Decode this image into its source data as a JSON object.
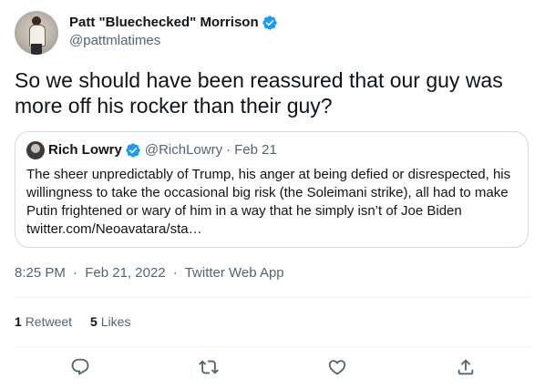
{
  "author": {
    "display_name": "Patt \"Bluechecked\" Morrison",
    "handle": "@pattmlatimes",
    "verified_icon": "verified-badge-icon"
  },
  "tweet": {
    "text": "So we should have been reassured that our guy was more off his rocker than their guy?"
  },
  "quoted_tweet": {
    "display_name": "Rich Lowry",
    "handle": "@RichLowry",
    "separator": "·",
    "date": "Feb 21",
    "text": "The sheer unpredictably of Trump, his anger at being defied or disrespected, his willingness to take the occasional big risk (the Soleimani strike), all had to make Putin frightened or wary of him in a way that he simply isn’t of Joe Biden twitter.com/Neoavatara/sta…"
  },
  "meta": {
    "time": "8:25 PM",
    "separator_1": "·",
    "date": "Feb 21, 2022",
    "separator_2": "·",
    "source": "Twitter Web App"
  },
  "stats": {
    "retweets_count": "1",
    "retweets_label": "Retweet",
    "likes_count": "5",
    "likes_label": "Likes"
  },
  "actions": [
    "reply-icon",
    "retweet-icon",
    "like-icon",
    "share-icon"
  ],
  "colors": {
    "verified": "#1d9bf0",
    "text": "#0f1419",
    "secondary": "#536471",
    "border": "#cfd9de"
  }
}
